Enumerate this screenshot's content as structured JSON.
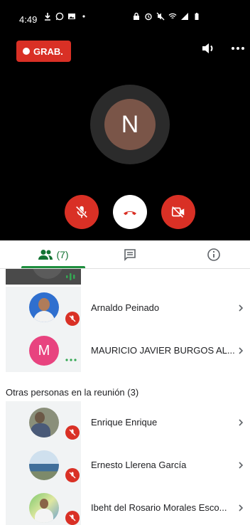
{
  "status_bar": {
    "time": "4:49",
    "left_icons": [
      "download-icon",
      "whatsapp-icon",
      "gallery-icon",
      "dot-icon"
    ],
    "right_icons": [
      "lock-icon",
      "alarm-icon",
      "mute-icon",
      "wifi-icon",
      "signal-icon",
      "battery-icon"
    ]
  },
  "call": {
    "record_label": "GRAB.",
    "speaker_initial": "N",
    "colors": {
      "record": "#d93025",
      "avatar": "#7a5548",
      "end_call_icon": "#d93025"
    }
  },
  "tabs": {
    "people_count": "(7)",
    "accent": "#1e8e3e"
  },
  "participants": {
    "in_call": [
      {
        "name": "Arnaldo Peinado",
        "muted": true
      },
      {
        "name": "MAURICIO JAVIER BURGOS AL...",
        "initial": "M",
        "avatar_color": "#e8437f",
        "muted": false
      }
    ],
    "others_label": "Otras personas en la reunión (3)",
    "others": [
      {
        "name": "Enrique Enrique",
        "muted": true
      },
      {
        "name": "Ernesto Llerena García",
        "muted": true
      },
      {
        "name": "Ibeht del Rosario Morales Esco...",
        "muted": true
      }
    ]
  }
}
